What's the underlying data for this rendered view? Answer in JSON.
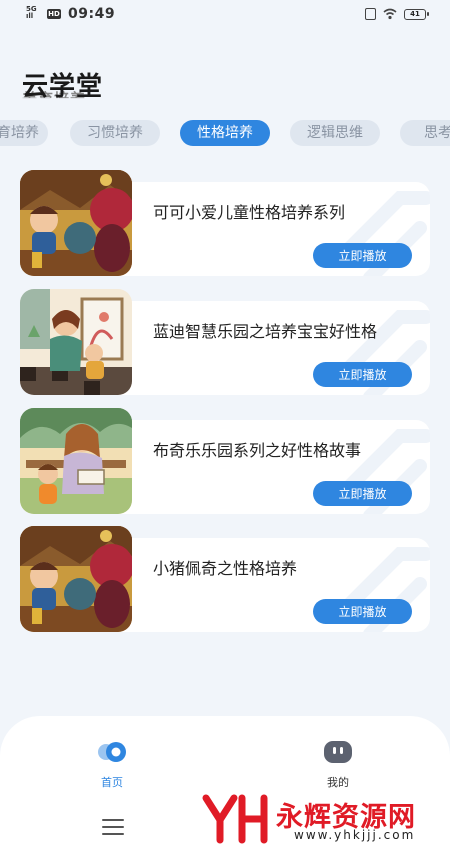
{
  "status_bar": {
    "signal": "5G",
    "signal_sub": "ıll",
    "hd": "HD",
    "time": "09:49",
    "battery": "41"
  },
  "header": {
    "title": "云学堂",
    "subtitle": "美育培养"
  },
  "tabs": [
    {
      "label": "美育培养",
      "active": false
    },
    {
      "label": "习惯培养",
      "active": false
    },
    {
      "label": "性格培养",
      "active": true
    },
    {
      "label": "逻辑思维",
      "active": false
    },
    {
      "label": "思考",
      "active": false
    }
  ],
  "cards": [
    {
      "title": "可可小爱儿童性格培养系列",
      "button": "立即播放",
      "thumb_icon": "cartoon-adventure-thumbnail"
    },
    {
      "title": "蓝迪智慧乐园之培养宝宝好性格",
      "button": "立即播放",
      "thumb_icon": "painting-mother-child-thumbnail"
    },
    {
      "title": "布奇乐乐园系列之好性格故事",
      "button": "立即播放",
      "thumb_icon": "reading-mother-child-thumbnail"
    },
    {
      "title": "小猪佩奇之性格培养",
      "button": "立即播放",
      "thumb_icon": "cartoon-adventure-thumbnail"
    }
  ],
  "bottom_nav": [
    {
      "label": "首页",
      "icon": "home-icon",
      "active": true
    },
    {
      "label": "我的",
      "icon": "profile-icon",
      "active": false
    }
  ],
  "watermark": {
    "logo": "YH",
    "text": "永辉资源网",
    "url": "www.yhkjjj.com"
  },
  "colors": {
    "accent": "#2f86e0",
    "background": "#f1f5fa",
    "watermark": "#e01b26"
  }
}
